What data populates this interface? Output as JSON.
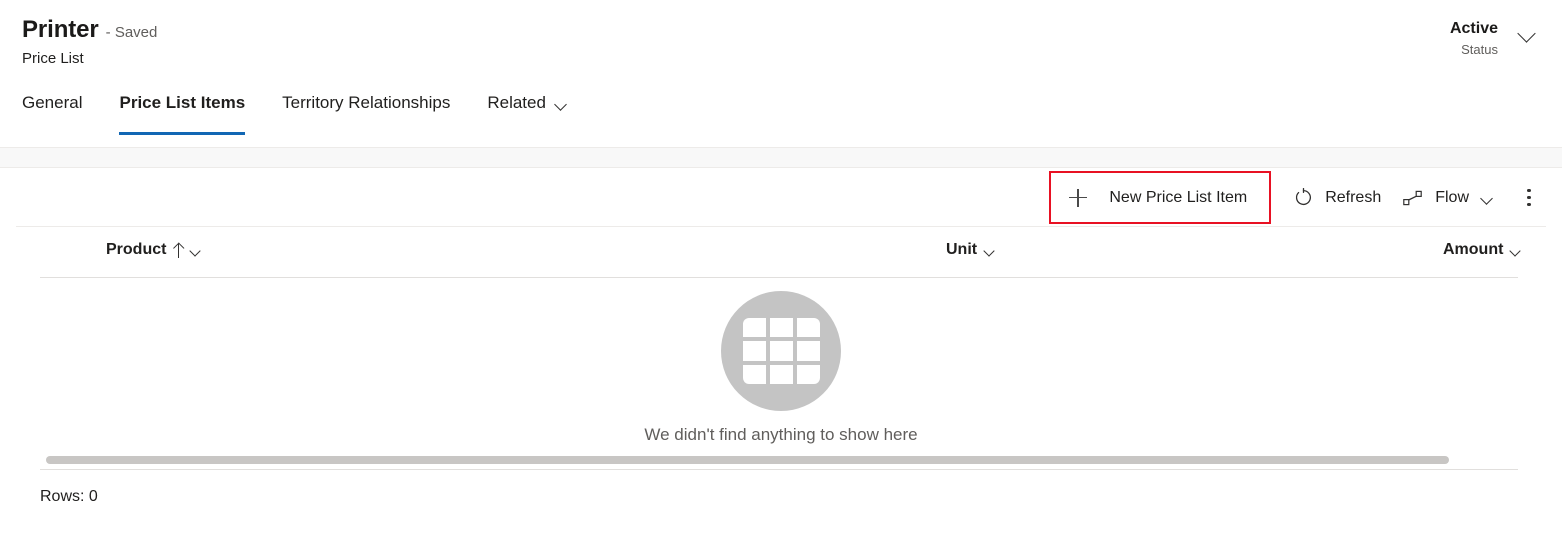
{
  "header": {
    "record_title": "Printer",
    "saved_state": "- Saved",
    "entity_name": "Price List",
    "status_value": "Active",
    "status_label": "Status",
    "status_chevron_icon": "chevron-down-icon"
  },
  "tabs": [
    {
      "label": "General",
      "selected": false
    },
    {
      "label": "Price List Items",
      "selected": true
    },
    {
      "label": "Territory Relationships",
      "selected": false
    },
    {
      "label": "Related",
      "selected": false,
      "chevron_icon": "chevron-down-icon"
    }
  ],
  "command_bar": {
    "new_item": {
      "label": "New Price List Item",
      "icon": "plus-icon",
      "highlighted": true
    },
    "refresh": {
      "label": "Refresh",
      "icon": "refresh-icon"
    },
    "flow": {
      "label": "Flow",
      "icon": "flow-icon",
      "chevron_icon": "chevron-down-icon"
    },
    "overflow": {
      "icon": "more-vertical-icon"
    }
  },
  "grid": {
    "columns": [
      {
        "label": "Product",
        "sort_icon": "sort-ascending-icon",
        "menu_icon": "chevron-down-icon"
      },
      {
        "label": "Unit",
        "menu_icon": "chevron-down-icon"
      },
      {
        "label": "Amount",
        "menu_icon": "chevron-down-icon"
      }
    ],
    "rows": [],
    "empty_state": {
      "illustration_icon": "grid-table-icon",
      "message": "We didn't find anything to show here"
    },
    "row_count_label": "Rows: 0"
  },
  "colors": {
    "accent_blue": "#1267b4",
    "highlight_red": "#e81123",
    "empty_state_gray": "#c4c4c4",
    "scrollbar_gray": "#c8c6c4",
    "band_gray": "#f8f8f8"
  }
}
